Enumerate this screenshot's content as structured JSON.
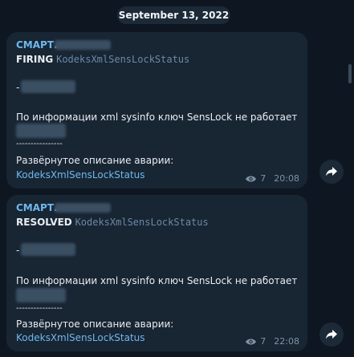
{
  "date_label": "September 13, 2022",
  "messages": [
    {
      "sender": "СМАРТ.",
      "status": "FIRING",
      "alert_name": "KodeksXmlSensLockStatus",
      "dash": "-",
      "description": "По информации xml sysinfo ключ SensLock не работает",
      "separator": "----------------",
      "details_label": "Развёрнутое описание аварии:",
      "details_link": "KodeksXmlSensLockStatus",
      "views": "7",
      "time": "20:08"
    },
    {
      "sender": "СМАРТ.",
      "status": "RESOLVED",
      "alert_name": "KodeksXmlSensLockStatus",
      "dash": "-",
      "description": "По информации xml sysinfo ключ SensLock не работает",
      "separator": "----------------",
      "details_label": "Развёрнутое описание аварии:",
      "details_link": "KodeksXmlSensLockStatus",
      "views": "7",
      "time": "22:08"
    }
  ],
  "icons": {
    "views": "eye-icon",
    "share": "share-arrow-icon"
  },
  "colors": {
    "background": "#0e1621",
    "bubble": "#182533",
    "accent": "#6fb8ee"
  }
}
